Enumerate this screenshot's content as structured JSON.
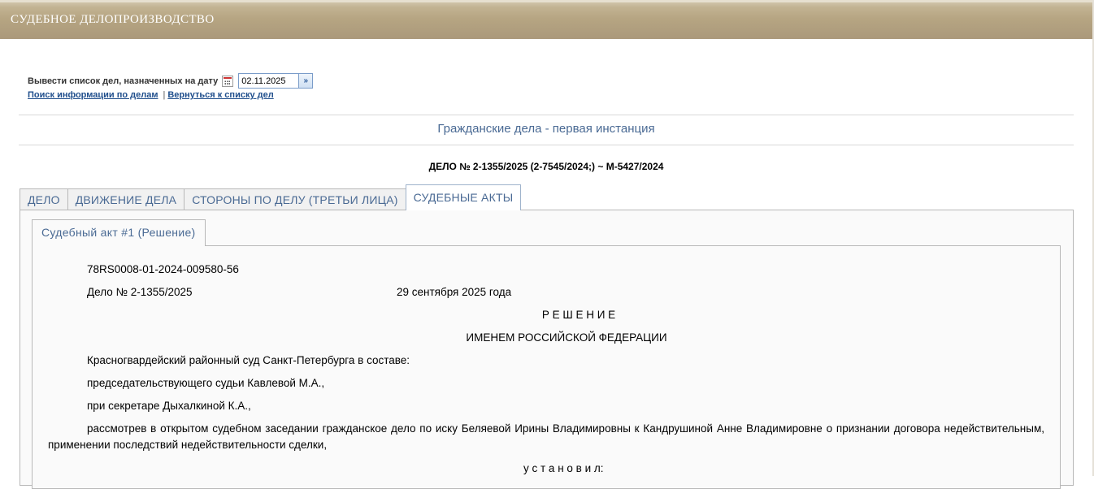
{
  "header": {
    "title": "СУДЕБНОЕ ДЕЛОПРОИЗВОДСТВО"
  },
  "date_filter": {
    "label": "Вывести список дел, назначенных на дату",
    "date_value": "02.11.2025",
    "go_glyph": "»"
  },
  "links": {
    "search": "Поиск информации по делам",
    "separator": "|",
    "back": "Вернуться к списку дел"
  },
  "section": {
    "title": "Гражданские дела - первая инстанция",
    "case_number": "ДЕЛО № 2-1355/2025 (2-7545/2024;) ~ М-5427/2024"
  },
  "tabs": [
    {
      "label": "ДЕЛО",
      "active": false
    },
    {
      "label": "ДВИЖЕНИЕ ДЕЛА",
      "active": false
    },
    {
      "label": "СТОРОНЫ ПО ДЕЛУ (ТРЕТЬИ ЛИЦА)",
      "active": false
    },
    {
      "label": "СУДЕБНЫЕ АКТЫ",
      "active": true
    }
  ],
  "subtab": {
    "label": "Судебный акт #1 (Решение)"
  },
  "document": {
    "uid": "78RS0008-01-2024-009580-56",
    "case_ref": "Дело № 2-1355/2025",
    "date": "29 сентября 2025 года",
    "heading": "Р Е Ш Е Н И Е",
    "subheading": "ИМЕНЕМ РОССИЙСКОЙ ФЕДЕРАЦИИ",
    "court": "Красногвардейский районный суд Санкт-Петербурга в составе:",
    "judge": "председательствующего судьи Кавлевой М.А.,",
    "secretary": "при секретаре Дыхалкиной К.А.,",
    "body": "рассмотрев в открытом судебном заседании гражданское дело по иску Беляевой Ирины Владимировны к Кандрушиной Анне Владимировне о признании договора недействительным, применении последствий недействительности сделки,",
    "established": "у с т а н о в и л:"
  },
  "colors": {
    "header_bg": "#b6a582",
    "link": "#1f4e8c",
    "tab_text": "#4a6a94"
  }
}
